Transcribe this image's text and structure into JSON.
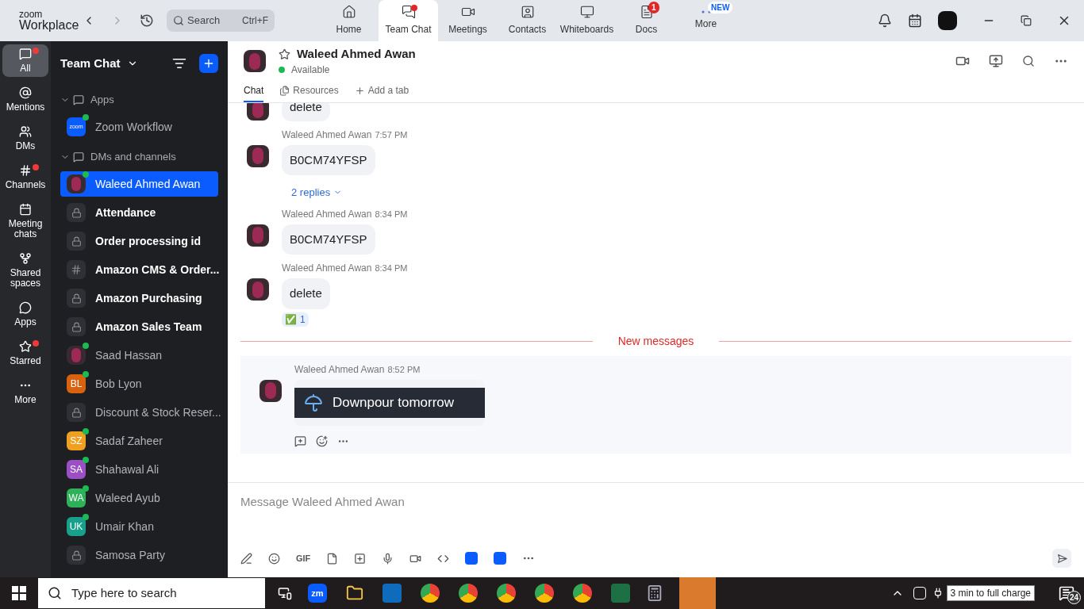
{
  "titlebar": {
    "logo_top": "zoom",
    "logo_bottom": "Workplace",
    "search": {
      "placeholder": "Search",
      "shortcut": "Ctrl+F"
    },
    "tabs": [
      {
        "label": "Home",
        "selected": false
      },
      {
        "label": "Team Chat",
        "selected": true,
        "dot": true
      },
      {
        "label": "Meetings",
        "selected": false
      },
      {
        "label": "Contacts",
        "selected": false
      },
      {
        "label": "Whiteboards",
        "selected": false
      },
      {
        "label": "Docs",
        "selected": false,
        "badge": "1"
      },
      {
        "label": "More",
        "selected": false,
        "badge": "NEW"
      }
    ]
  },
  "rail": [
    {
      "label": "All",
      "selected": true,
      "dot": true
    },
    {
      "label": "Mentions",
      "selected": false,
      "dot": false
    },
    {
      "label": "DMs",
      "selected": false,
      "dot": false
    },
    {
      "label": "Channels",
      "selected": false,
      "dot": true
    },
    {
      "label": "Meeting chats",
      "selected": false,
      "dot": false
    },
    {
      "label": "Shared spaces",
      "selected": false,
      "dot": false
    },
    {
      "label": "Apps",
      "selected": false,
      "dot": false
    },
    {
      "label": "Starred",
      "selected": false,
      "dot": true
    },
    {
      "label": "More",
      "selected": false,
      "dot": false
    }
  ],
  "sidebar": {
    "title": "Team Chat",
    "sections": [
      {
        "label": "Apps",
        "expanded": true,
        "items": [
          {
            "name": "Zoom Workflow",
            "kind": "app",
            "badge": "zoom",
            "online": true,
            "bold": false,
            "selected": false
          }
        ]
      },
      {
        "label": "DMs and channels",
        "expanded": true,
        "items": [
          {
            "name": "Waleed Ahmed Awan",
            "kind": "photo",
            "online": true,
            "bold": false,
            "selected": true
          },
          {
            "name": "Attendance",
            "kind": "lock",
            "online": false,
            "bold": true,
            "selected": false
          },
          {
            "name": "Order processing id",
            "kind": "lock",
            "online": false,
            "bold": true,
            "selected": false
          },
          {
            "name": "Amazon CMS & Order...",
            "kind": "hash",
            "online": false,
            "bold": true,
            "selected": false
          },
          {
            "name": "Amazon Purchasing",
            "kind": "lock",
            "online": false,
            "bold": true,
            "selected": false
          },
          {
            "name": "Amazon Sales Team",
            "kind": "lock",
            "online": false,
            "bold": true,
            "selected": false
          },
          {
            "name": "Saad Hassan",
            "kind": "photo",
            "online": true,
            "bold": false,
            "selected": false
          },
          {
            "name": "Bob Lyon",
            "kind": "initials",
            "initials": "BL",
            "color": "#d9620f",
            "online": true,
            "bold": false,
            "selected": false
          },
          {
            "name": "Discount & Stock Reser...",
            "kind": "lock",
            "online": false,
            "bold": false,
            "selected": false
          },
          {
            "name": "Sadaf Zaheer",
            "kind": "initials",
            "initials": "SZ",
            "color": "#f0a020",
            "online": true,
            "bold": false,
            "selected": false
          },
          {
            "name": "Shahawal Ali",
            "kind": "initials",
            "initials": "SA",
            "color": "#9b4fc4",
            "online": true,
            "bold": false,
            "selected": false
          },
          {
            "name": "Waleed Ayub",
            "kind": "initials",
            "initials": "WA",
            "color": "#2fb15a",
            "online": true,
            "bold": false,
            "selected": false
          },
          {
            "name": "Umair Khan",
            "kind": "initials",
            "initials": "UK",
            "color": "#17a08a",
            "online": true,
            "bold": false,
            "selected": false
          },
          {
            "name": "Samosa Party",
            "kind": "lock",
            "online": false,
            "bold": false,
            "selected": false
          }
        ]
      }
    ]
  },
  "chat": {
    "name": "Waleed Ahmed Awan",
    "status": "Available",
    "starred": false,
    "tabs": [
      {
        "label": "Chat",
        "selected": true
      },
      {
        "label": "Resources",
        "selected": false
      },
      {
        "label": "Add a tab",
        "selected": false
      }
    ],
    "messages": [
      {
        "kind": "text",
        "text": "delete",
        "partial": true
      },
      {
        "kind": "text",
        "sender": "Waleed Ahmed Awan",
        "time": "7:57 PM",
        "text": "B0CM74YFSP",
        "replies": "2 replies"
      },
      {
        "kind": "text",
        "sender": "Waleed Ahmed Awan",
        "time": "8:34 PM",
        "text": "B0CM74YFSP"
      },
      {
        "kind": "text",
        "sender": "Waleed Ahmed Awan",
        "time": "8:34 PM",
        "text": "delete",
        "reaction": {
          "emoji": "✅",
          "count": "1"
        }
      },
      {
        "kind": "divider",
        "text": "New messages"
      },
      {
        "kind": "card",
        "sender": "Waleed Ahmed Awan",
        "time": "8:52 PM",
        "text": "Downpour tomorrow",
        "hovered": true
      }
    ],
    "composer": {
      "placeholder": "Message Waleed Ahmed Awan",
      "gif": "GIF"
    }
  },
  "taskbar": {
    "search_placeholder": "Type here to search",
    "zoom_label": "zm",
    "tooltip": "3 min to full charge",
    "notifications": "24"
  }
}
